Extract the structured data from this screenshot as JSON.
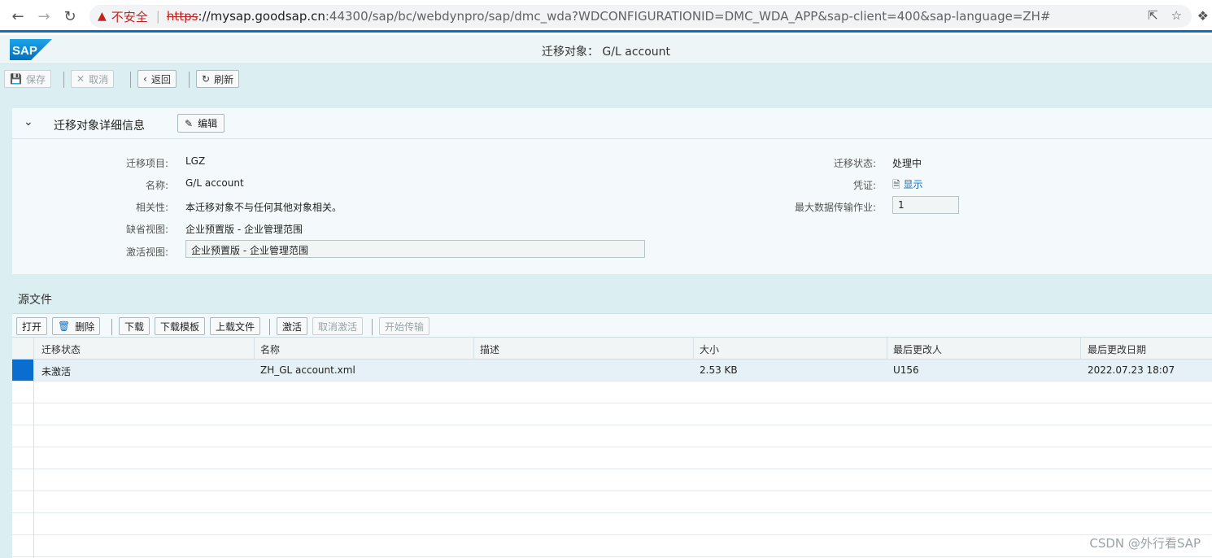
{
  "browser": {
    "security_label": "不安全",
    "url_scheme": "https",
    "url_host": "://mysap.goodsap.cn",
    "url_rest": ":44300/sap/bc/webdynpro/sap/dmc_wda?WDCONFIGURATIONID=DMC_WDA_APP&sap-client=400&sap-language=ZH#"
  },
  "shell": {
    "logo_text": "SAP",
    "title": "迁移对象： G/L account"
  },
  "toolbar": {
    "save": "保存",
    "cancel": "取消",
    "back": "返回",
    "refresh": "刷新"
  },
  "details": {
    "title": "迁移对象详细信息",
    "edit": "编辑",
    "fields": {
      "project_label": "迁移项目:",
      "project_value": "LGZ",
      "name_label": "名称:",
      "name_value": "G/L account",
      "relevance_label": "相关性:",
      "relevance_value": "本迁移对象不与任何其他对象相关。",
      "default_view_label": "缺省视图:",
      "default_view_value": "企业预置版 - 企业管理范围",
      "active_view_label": "激活视图:",
      "active_view_value": "企业预置版 - 企业管理范围",
      "status_label": "迁移状态:",
      "status_value": "处理中",
      "voucher_label": "凭证:",
      "voucher_value": "显示",
      "max_jobs_label": "最大数据传输作业:",
      "max_jobs_value": "1"
    }
  },
  "source_files": {
    "title": "源文件",
    "buttons": {
      "open": "打开",
      "delete": "删除",
      "download": "下载",
      "download_template": "下载模板",
      "upload": "上载文件",
      "activate": "激活",
      "deactivate": "取消激活",
      "start_transfer": "开始传输"
    },
    "columns": [
      "迁移状态",
      "名称",
      "描述",
      "大小",
      "最后更改人",
      "最后更改日期"
    ],
    "rows": [
      [
        "未激活",
        "ZH_GL account.xml",
        "",
        "2.53 KB",
        "U156",
        "2022.07.23 18:07"
      ]
    ]
  },
  "watermark": "CSDN @外行看SAP",
  "colors": {
    "accent": "#0a6ed1",
    "background": "#dbeef1",
    "panel": "#f4fafb",
    "warning": "#c5221f"
  }
}
